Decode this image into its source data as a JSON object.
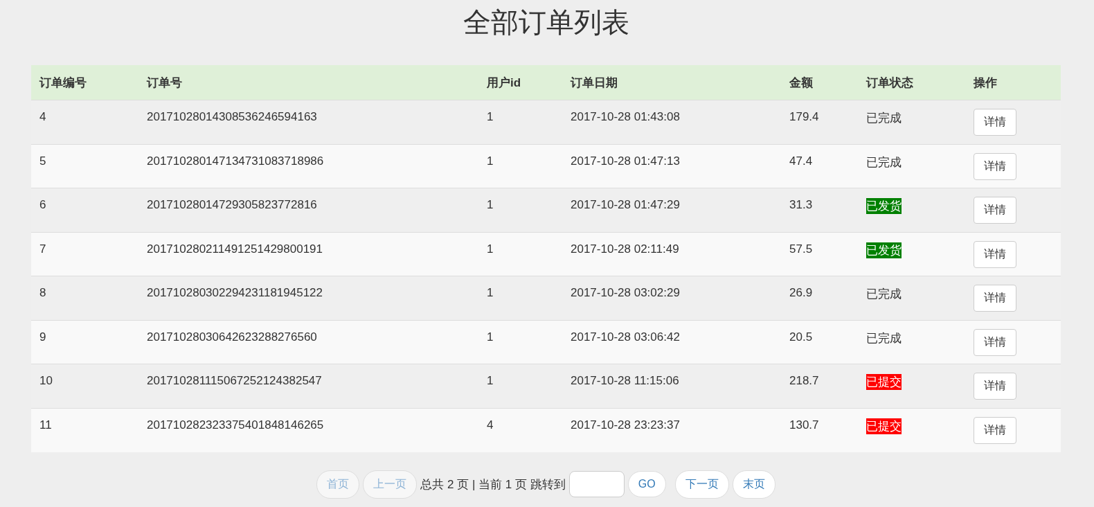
{
  "title": "全部订单列表",
  "table": {
    "columns": [
      "订单编号",
      "订单号",
      "用户id",
      "订单日期",
      "金额",
      "订单状态",
      "操作"
    ],
    "rows": [
      {
        "id": "4",
        "order_no": "20171028014308536246594163",
        "user_id": "1",
        "date": "2017-10-28 01:43:08",
        "amount": "179.4",
        "status": "已完成",
        "action": "详情"
      },
      {
        "id": "5",
        "order_no": "201710280147134731083718986",
        "user_id": "1",
        "date": "2017-10-28 01:47:13",
        "amount": "47.4",
        "status": "已完成",
        "action": "详情"
      },
      {
        "id": "6",
        "order_no": "20171028014729305823772816",
        "user_id": "1",
        "date": "2017-10-28 01:47:29",
        "amount": "31.3",
        "status": "已发货",
        "color": "#008000",
        "action": "详情"
      },
      {
        "id": "7",
        "order_no": "201710280211491251429800191",
        "user_id": "1",
        "date": "2017-10-28 02:11:49",
        "amount": "57.5",
        "status": "已发货",
        "color": "#008000",
        "action": "详情"
      },
      {
        "id": "8",
        "order_no": "201710280302294231181945122",
        "user_id": "1",
        "date": "2017-10-28 03:02:29",
        "amount": "26.9",
        "status": "已完成",
        "action": "详情"
      },
      {
        "id": "9",
        "order_no": "20171028030642623288276560",
        "user_id": "1",
        "date": "2017-10-28 03:06:42",
        "amount": "20.5",
        "status": "已完成",
        "action": "详情"
      },
      {
        "id": "10",
        "order_no": "201710281115067252124382547",
        "user_id": "1",
        "date": "2017-10-28 11:15:06",
        "amount": "218.7",
        "status": "已提交",
        "color": "#ff0000",
        "action": "详情"
      },
      {
        "id": "11",
        "order_no": "201710282323375401848146265",
        "user_id": "4",
        "date": "2017-10-28 23:23:37",
        "amount": "130.7",
        "status": "已提交",
        "color": "#ff0000",
        "action": "详情"
      }
    ]
  },
  "pager": {
    "first": {
      "label": "首页",
      "disabled": true
    },
    "prev": {
      "label": "上一页",
      "disabled": true
    },
    "summary": "总共 2 页 | 当前 1 页 跳转到",
    "go": {
      "label": "GO",
      "disabled": false
    },
    "next": {
      "label": "下一页",
      "disabled": false
    },
    "last": {
      "label": "末页",
      "disabled": false
    }
  }
}
